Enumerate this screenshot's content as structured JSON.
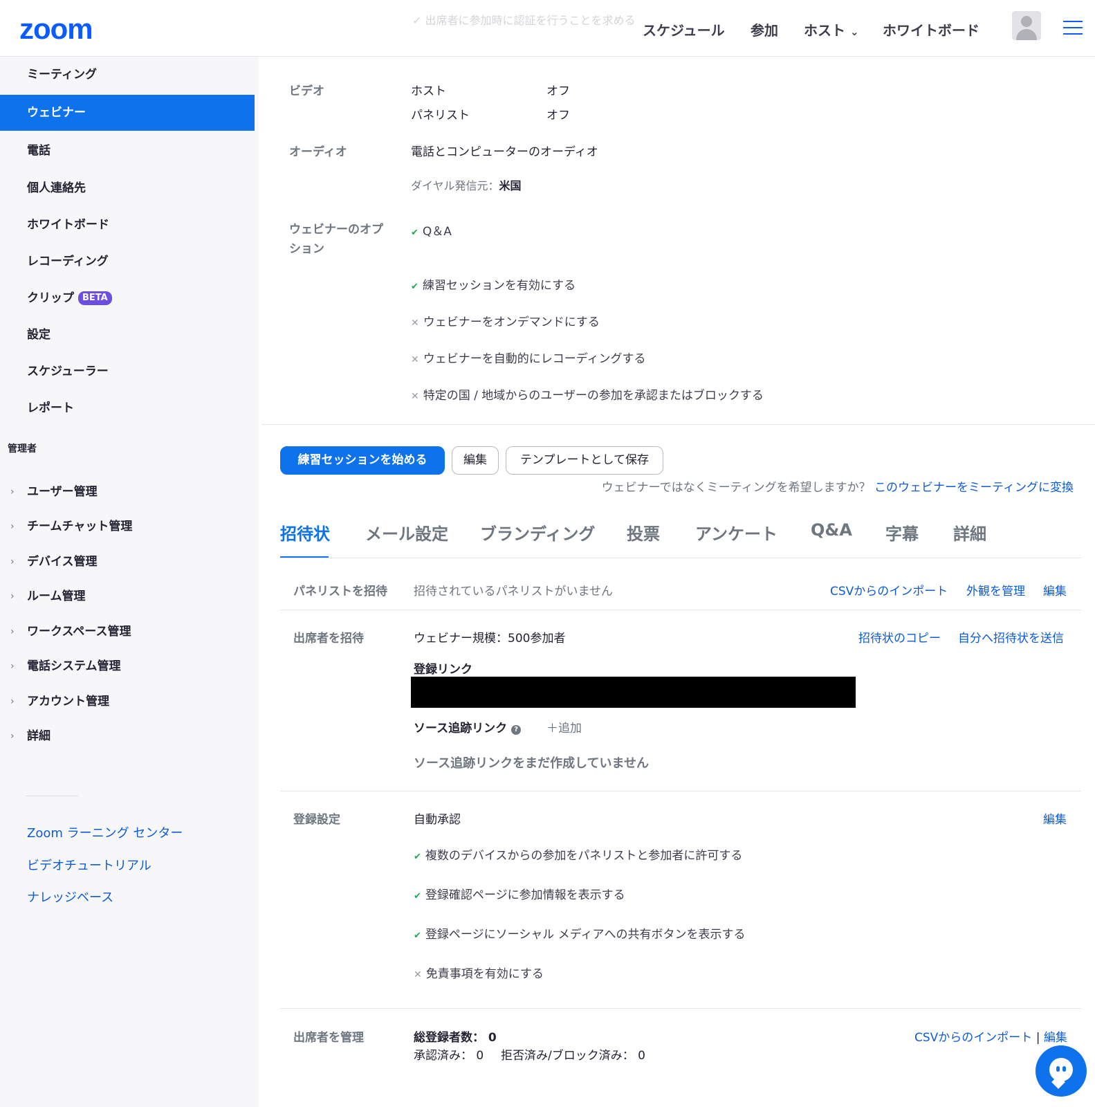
{
  "header": {
    "logo": "zoom",
    "faded_text": "✓ 出席者に参加時に認証を行うことを求める",
    "nav": [
      "スケジュール",
      "参加",
      "ホスト",
      "ホワイトボード"
    ],
    "host_caret": "⌄"
  },
  "sidebar": {
    "items": [
      "ミーティング",
      "ウェビナー",
      "電話",
      "個人連絡先",
      "ホワイトボード",
      "レコーディング",
      "クリップ",
      "設定",
      "スケジューラー",
      "レポート"
    ],
    "beta_badge": "BETA",
    "admin_heading": "管理者",
    "admin_items": [
      "ユーザー管理",
      "チームチャット管理",
      "デバイス管理",
      "ルーム管理",
      "ワークスペース管理",
      "電話システム管理",
      "アカウント管理",
      "詳細"
    ],
    "links": [
      "Zoom ラーニング センター",
      "ビデオチュートリアル",
      "ナレッジベース"
    ]
  },
  "video": {
    "label": "ビデオ",
    "host_label": "ホスト",
    "host_value": "オフ",
    "panelist_label": "パネリスト",
    "panelist_value": "オフ"
  },
  "audio": {
    "label": "オーディオ",
    "value": "電話とコンピューターのオーディオ",
    "dial_label": "ダイヤル発信元：",
    "dial_value": "米国"
  },
  "options": {
    "label_line1": "ウェビナーのオプ",
    "label_line2": "ション",
    "items": [
      {
        "text": "Q＆A",
        "enabled": true
      },
      {
        "text": "練習セッションを有効にする",
        "enabled": true
      },
      {
        "text": "ウェビナーをオンデマンドにする",
        "enabled": false
      },
      {
        "text": "ウェビナーを自動的にレコーディングする",
        "enabled": false
      },
      {
        "text": "特定の国 / 地域からのユーザーの参加を承認またはブロックする",
        "enabled": false
      }
    ]
  },
  "actions": {
    "practice": "練習セッションを始める",
    "edit": "編集",
    "save_template": "テンプレートとして保存",
    "convert_q": "ウェビナーではなくミーティングを希望しますか？",
    "convert_link": "このウェビナーをミーティングに変換"
  },
  "tabs": [
    "招待状",
    "メール設定",
    "ブランディング",
    "投票",
    "アンケート",
    "Q&A",
    "字幕",
    "詳細"
  ],
  "panelists": {
    "label": "パネリストを招待",
    "value": "招待されているパネリストがいません",
    "links": [
      "CSVからのインポート",
      "外観を管理",
      "編集"
    ]
  },
  "attendees": {
    "label": "出席者を招待",
    "scale": "ウェビナー規模：500参加者",
    "links": [
      "招待状のコピー",
      "自分へ招待状を送信"
    ],
    "reg_link_label": "登録リンク",
    "source_label": "ソース追跡リンク",
    "help_glyph": "?",
    "add": "＋追加",
    "none": "ソース追跡リンクをまだ作成していません"
  },
  "registration": {
    "label": "登録設定",
    "mode": "自動承認",
    "edit": "編集",
    "items": [
      {
        "text": "複数のデバイスからの参加をパネリストと参加者に許可する",
        "enabled": true
      },
      {
        "text": "登録確認ページに参加情報を表示する",
        "enabled": true
      },
      {
        "text": "登録ページにソーシャル メディアへの共有ボタンを表示する",
        "enabled": true
      },
      {
        "text": "免責事項を有効にする",
        "enabled": false
      }
    ]
  },
  "manage": {
    "label": "出席者を管理",
    "total": "総登録者数： 0",
    "approved": "承認済み： 0",
    "rejected": "拒否済み/ブロック済み： 0",
    "import": "CSVからのインポート",
    "separator": "|",
    "edit": "編集"
  },
  "glyphs": {
    "check": "✔",
    "cross": "✕",
    "chevron": "›"
  },
  "colors": {
    "accent": "#0e72ed",
    "link": "#0e5bd6",
    "check": "#23a55a",
    "beta": "#6d4ee0"
  }
}
